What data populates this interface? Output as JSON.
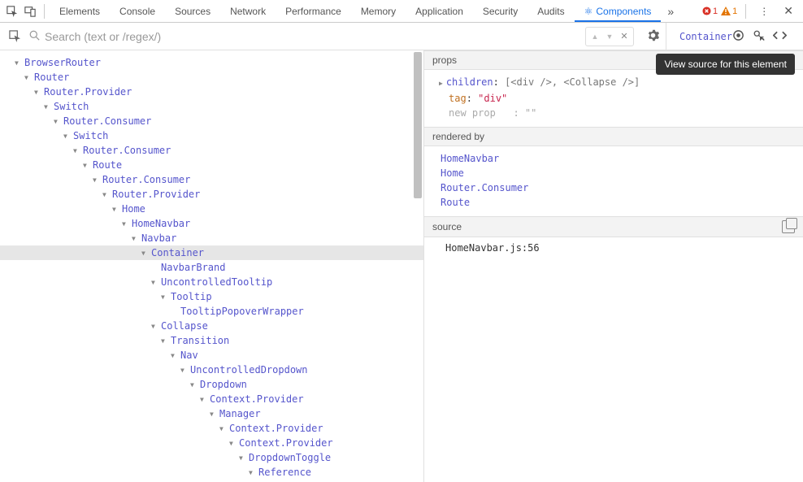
{
  "topTabs": {
    "elements": "Elements",
    "console": "Console",
    "sources": "Sources",
    "network": "Network",
    "performance": "Performance",
    "memory": "Memory",
    "application": "Application",
    "security": "Security",
    "audits": "Audits",
    "components": "Components"
  },
  "errors": {
    "count": "1"
  },
  "warnings": {
    "count": "1"
  },
  "search": {
    "placeholder": "Search (text or /regex/)"
  },
  "selectedComponent": "Container",
  "tree": [
    {
      "label": "BrowserRouter",
      "depth": 0,
      "caret": "down"
    },
    {
      "label": "Router",
      "depth": 1,
      "caret": "down"
    },
    {
      "label": "Router.Provider",
      "depth": 2,
      "caret": "down"
    },
    {
      "label": "Switch",
      "depth": 3,
      "caret": "down"
    },
    {
      "label": "Router.Consumer",
      "depth": 4,
      "caret": "down"
    },
    {
      "label": "Switch",
      "depth": 5,
      "caret": "down"
    },
    {
      "label": "Router.Consumer",
      "depth": 6,
      "caret": "down"
    },
    {
      "label": "Route",
      "depth": 7,
      "caret": "down"
    },
    {
      "label": "Router.Consumer",
      "depth": 8,
      "caret": "down"
    },
    {
      "label": "Router.Provider",
      "depth": 9,
      "caret": "down"
    },
    {
      "label": "Home",
      "depth": 10,
      "caret": "down"
    },
    {
      "label": "HomeNavbar",
      "depth": 11,
      "caret": "down"
    },
    {
      "label": "Navbar",
      "depth": 12,
      "caret": "down"
    },
    {
      "label": "Container",
      "depth": 13,
      "caret": "down",
      "selected": true
    },
    {
      "label": "NavbarBrand",
      "depth": 14,
      "caret": "none"
    },
    {
      "label": "UncontrolledTooltip",
      "depth": 14,
      "caret": "down"
    },
    {
      "label": "Tooltip",
      "depth": 15,
      "caret": "down"
    },
    {
      "label": "TooltipPopoverWrapper",
      "depth": 16,
      "caret": "none"
    },
    {
      "label": "Collapse",
      "depth": 14,
      "caret": "down"
    },
    {
      "label": "Transition",
      "depth": 15,
      "caret": "down"
    },
    {
      "label": "Nav",
      "depth": 16,
      "caret": "down"
    },
    {
      "label": "UncontrolledDropdown",
      "depth": 17,
      "caret": "down"
    },
    {
      "label": "Dropdown",
      "depth": 18,
      "caret": "down"
    },
    {
      "label": "Context.Provider",
      "depth": 19,
      "caret": "down"
    },
    {
      "label": "Manager",
      "depth": 20,
      "caret": "down"
    },
    {
      "label": "Context.Provider",
      "depth": 21,
      "caret": "down"
    },
    {
      "label": "Context.Provider",
      "depth": 22,
      "caret": "down"
    },
    {
      "label": "DropdownToggle",
      "depth": 23,
      "caret": "down"
    },
    {
      "label": "Reference",
      "depth": 24,
      "caret": "down"
    }
  ],
  "props": {
    "header": "props",
    "children_key": "children",
    "children_val": "[<div />, <Collapse />]",
    "tag_key": "tag",
    "tag_val": "\"div\"",
    "newprop_key": "new prop",
    "newprop_val": "\"\""
  },
  "renderedBy": {
    "header": "rendered by",
    "items": [
      "HomeNavbar",
      "Home",
      "Router.Consumer",
      "Route"
    ]
  },
  "source": {
    "header": "source",
    "location": "HomeNavbar.js:56"
  },
  "tooltip": "View source for this element"
}
